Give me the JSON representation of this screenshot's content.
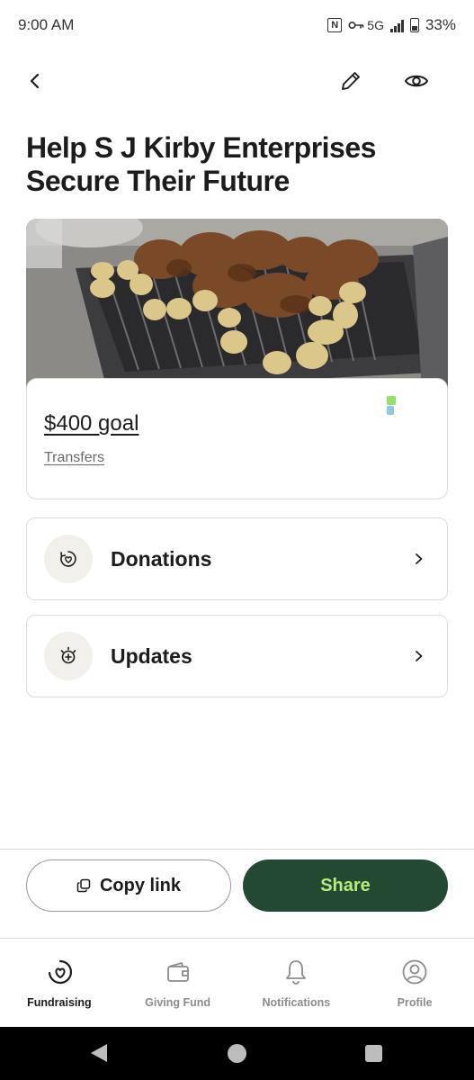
{
  "status_bar": {
    "time": "9:00 AM",
    "network": "5G",
    "battery": "33%",
    "icons": [
      "nfc-icon",
      "vpn-key-icon",
      "signal-icon",
      "battery-icon"
    ]
  },
  "nav": {
    "icons": [
      "back-arrow-icon",
      "pencil-icon",
      "eye-icon"
    ]
  },
  "fundraiser": {
    "title": "Help S J Kirby Enterprises Secure Their Future",
    "photo": "grilled-chicken-and-potatoes-on-barbecue",
    "goal": "$400 goal",
    "transfers": "Transfers",
    "progress_colors": [
      "#8fe36a",
      "#8ec9e8"
    ]
  },
  "rows": [
    {
      "label": "Donations",
      "icon": "heart-in-circle-icon"
    },
    {
      "label": "Updates",
      "icon": "sparkle-plus-icon"
    }
  ],
  "actions": {
    "copy_link": "Copy link",
    "share": "Share"
  },
  "tabs": [
    {
      "label": "Fundraising",
      "icon": "heart-swirl-icon",
      "active": true
    },
    {
      "label": "Giving Fund",
      "icon": "wallet-icon",
      "active": false
    },
    {
      "label": "Notifications",
      "icon": "bell-icon",
      "active": false
    },
    {
      "label": "Profile",
      "icon": "profile-icon",
      "active": false
    }
  ],
  "colors": {
    "share_bg": "#224a33",
    "share_text": "#b7eb7d",
    "border": "#dedcd4"
  }
}
